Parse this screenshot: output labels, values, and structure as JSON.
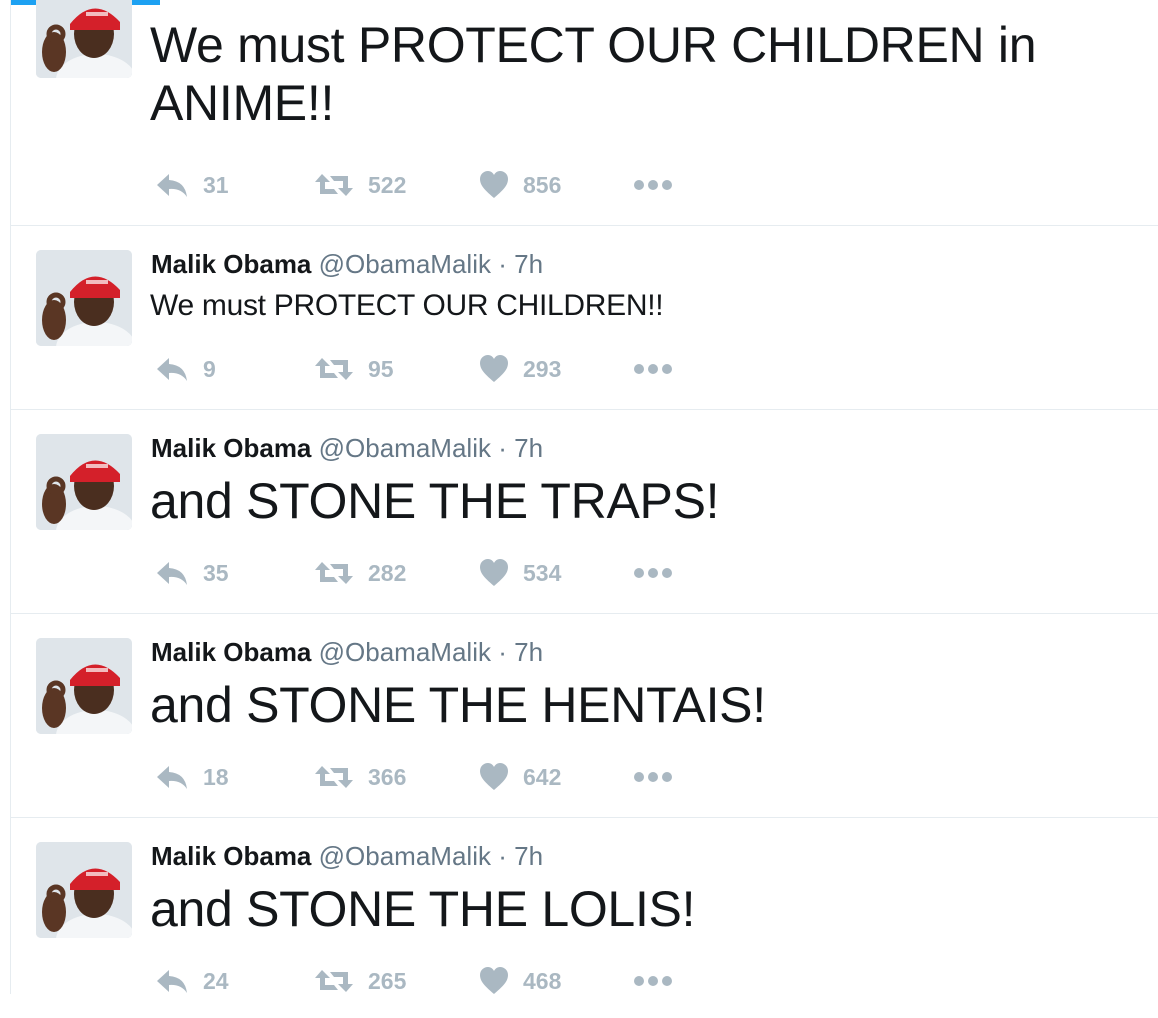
{
  "colors": {
    "accent": "#1da1f2",
    "name": "#14171a",
    "meta": "#657786",
    "action": "#aab8c2",
    "divider": "#e6ecf0",
    "hat": "#d4202a"
  },
  "tweets": [
    {
      "name": "",
      "handle": "",
      "dot": "",
      "time": "",
      "text": "We must PROTECT OUR CHILDREN in ANIME!!",
      "replies": "31",
      "retweets": "522",
      "likes": "856"
    },
    {
      "name": "Malik Obama",
      "handle": "@ObamaMalik",
      "dot": "·",
      "time": "7h",
      "text": "We must PROTECT OUR CHILDREN!!",
      "replies": "9",
      "retweets": "95",
      "likes": "293"
    },
    {
      "name": "Malik Obama",
      "handle": "@ObamaMalik",
      "dot": "·",
      "time": "7h",
      "text": "and STONE THE TRAPS!",
      "replies": "35",
      "retweets": "282",
      "likes": "534"
    },
    {
      "name": "Malik Obama",
      "handle": "@ObamaMalik",
      "dot": "·",
      "time": "7h",
      "text": "and STONE THE HENTAIS!",
      "replies": "18",
      "retweets": "366",
      "likes": "642"
    },
    {
      "name": "Malik Obama",
      "handle": "@ObamaMalik",
      "dot": "·",
      "time": "7h",
      "text": "and STONE THE LOLIS!",
      "replies": "24",
      "retweets": "265",
      "likes": "468"
    }
  ],
  "icons": {
    "reply": "reply-icon",
    "retweet": "retweet-icon",
    "like": "heart-icon",
    "more": "more-dots-icon",
    "avatar": "avatar-photo"
  }
}
